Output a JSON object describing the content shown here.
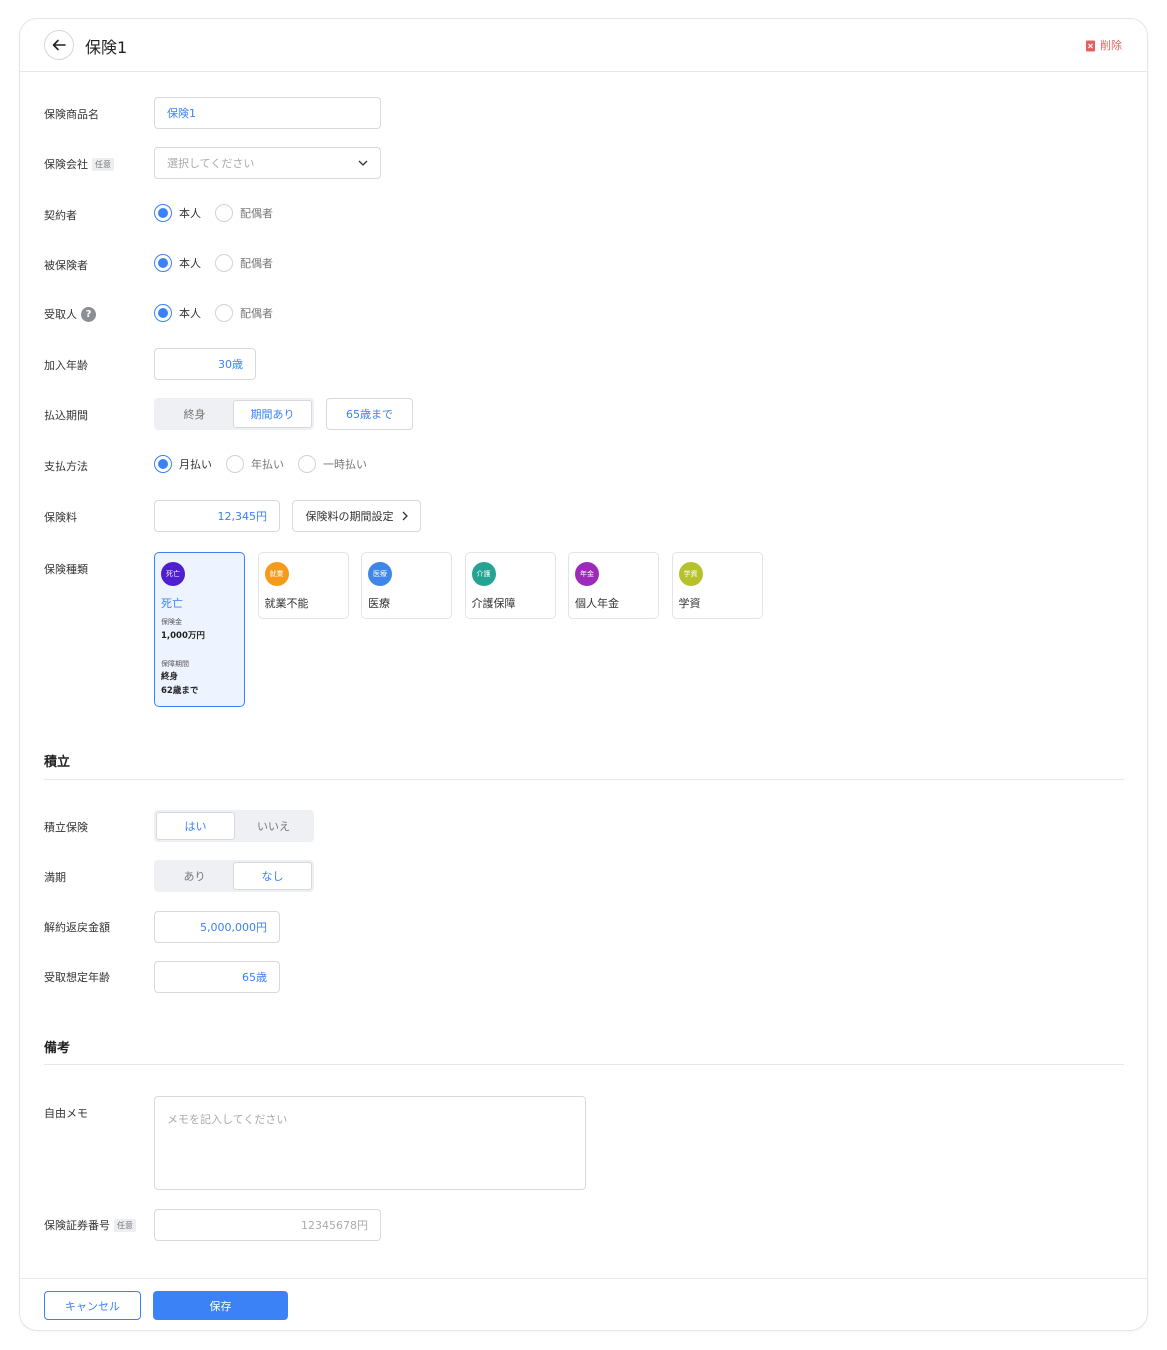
{
  "header": {
    "title": "保険1",
    "delete_label": "削除"
  },
  "fields": {
    "product_name": {
      "label": "保険商品名",
      "value": "保険1"
    },
    "company": {
      "label": "保険会社",
      "tag": "任意",
      "placeholder": "選択してください"
    },
    "contractor": {
      "label": "契約者",
      "options": [
        "本人",
        "配偶者"
      ],
      "selected": "本人"
    },
    "insured": {
      "label": "被保険者",
      "options": [
        "本人",
        "配偶者"
      ],
      "selected": "本人"
    },
    "recipient": {
      "label": "受取人",
      "help": "?",
      "options": [
        "本人",
        "配偶者"
      ],
      "selected": "本人"
    },
    "join_age": {
      "label": "加入年齢",
      "value": "30歳"
    },
    "payment_period": {
      "label": "払込期間",
      "options": [
        "終身",
        "期間あり"
      ],
      "selected": "期間あり",
      "until": "65歳まで"
    },
    "payment_method": {
      "label": "支払方法",
      "options": [
        "月払い",
        "年払い",
        "一時払い"
      ],
      "selected": "月払い"
    },
    "premium": {
      "label": "保険料",
      "value": "12,345円",
      "period_button": "保険料の期間設定"
    },
    "types": {
      "label": "保険種類",
      "items": [
        {
          "badge": "死亡",
          "name": "死亡",
          "color": "#4f1fcf",
          "selected": true
        },
        {
          "badge": "就業",
          "name": "就業不能",
          "color": "#f59a1b"
        },
        {
          "badge": "医療",
          "name": "医療",
          "color": "#3f86e8"
        },
        {
          "badge": "介護",
          "name": "介護保障",
          "color": "#24a394"
        },
        {
          "badge": "年金",
          "name": "個人年金",
          "color": "#9b2bb8"
        },
        {
          "badge": "学資",
          "name": "学資",
          "color": "#b6c12c"
        }
      ],
      "detail": {
        "amount_label": "保険金",
        "amount": "1,000万円",
        "period_label": "保障期間",
        "period": "終身",
        "until": "62歳まで"
      }
    }
  },
  "savings": {
    "title": "積立",
    "is_savings": {
      "label": "積立保険",
      "options": [
        "はい",
        "いいえ"
      ],
      "selected": "はい"
    },
    "maturity": {
      "label": "満期",
      "options": [
        "あり",
        "なし"
      ],
      "selected": "なし"
    },
    "surrender": {
      "label": "解約返戻金額",
      "value": "5,000,000円"
    },
    "receive_age": {
      "label": "受取想定年齢",
      "value": "65歳"
    }
  },
  "notes": {
    "title": "備考",
    "memo": {
      "label": "自由メモ",
      "placeholder": "メモを記入してください"
    },
    "policy_number": {
      "label": "保険証券番号",
      "tag": "任意",
      "placeholder": "12345678円"
    }
  },
  "footer": {
    "cancel": "キャンセル",
    "save": "保存"
  }
}
